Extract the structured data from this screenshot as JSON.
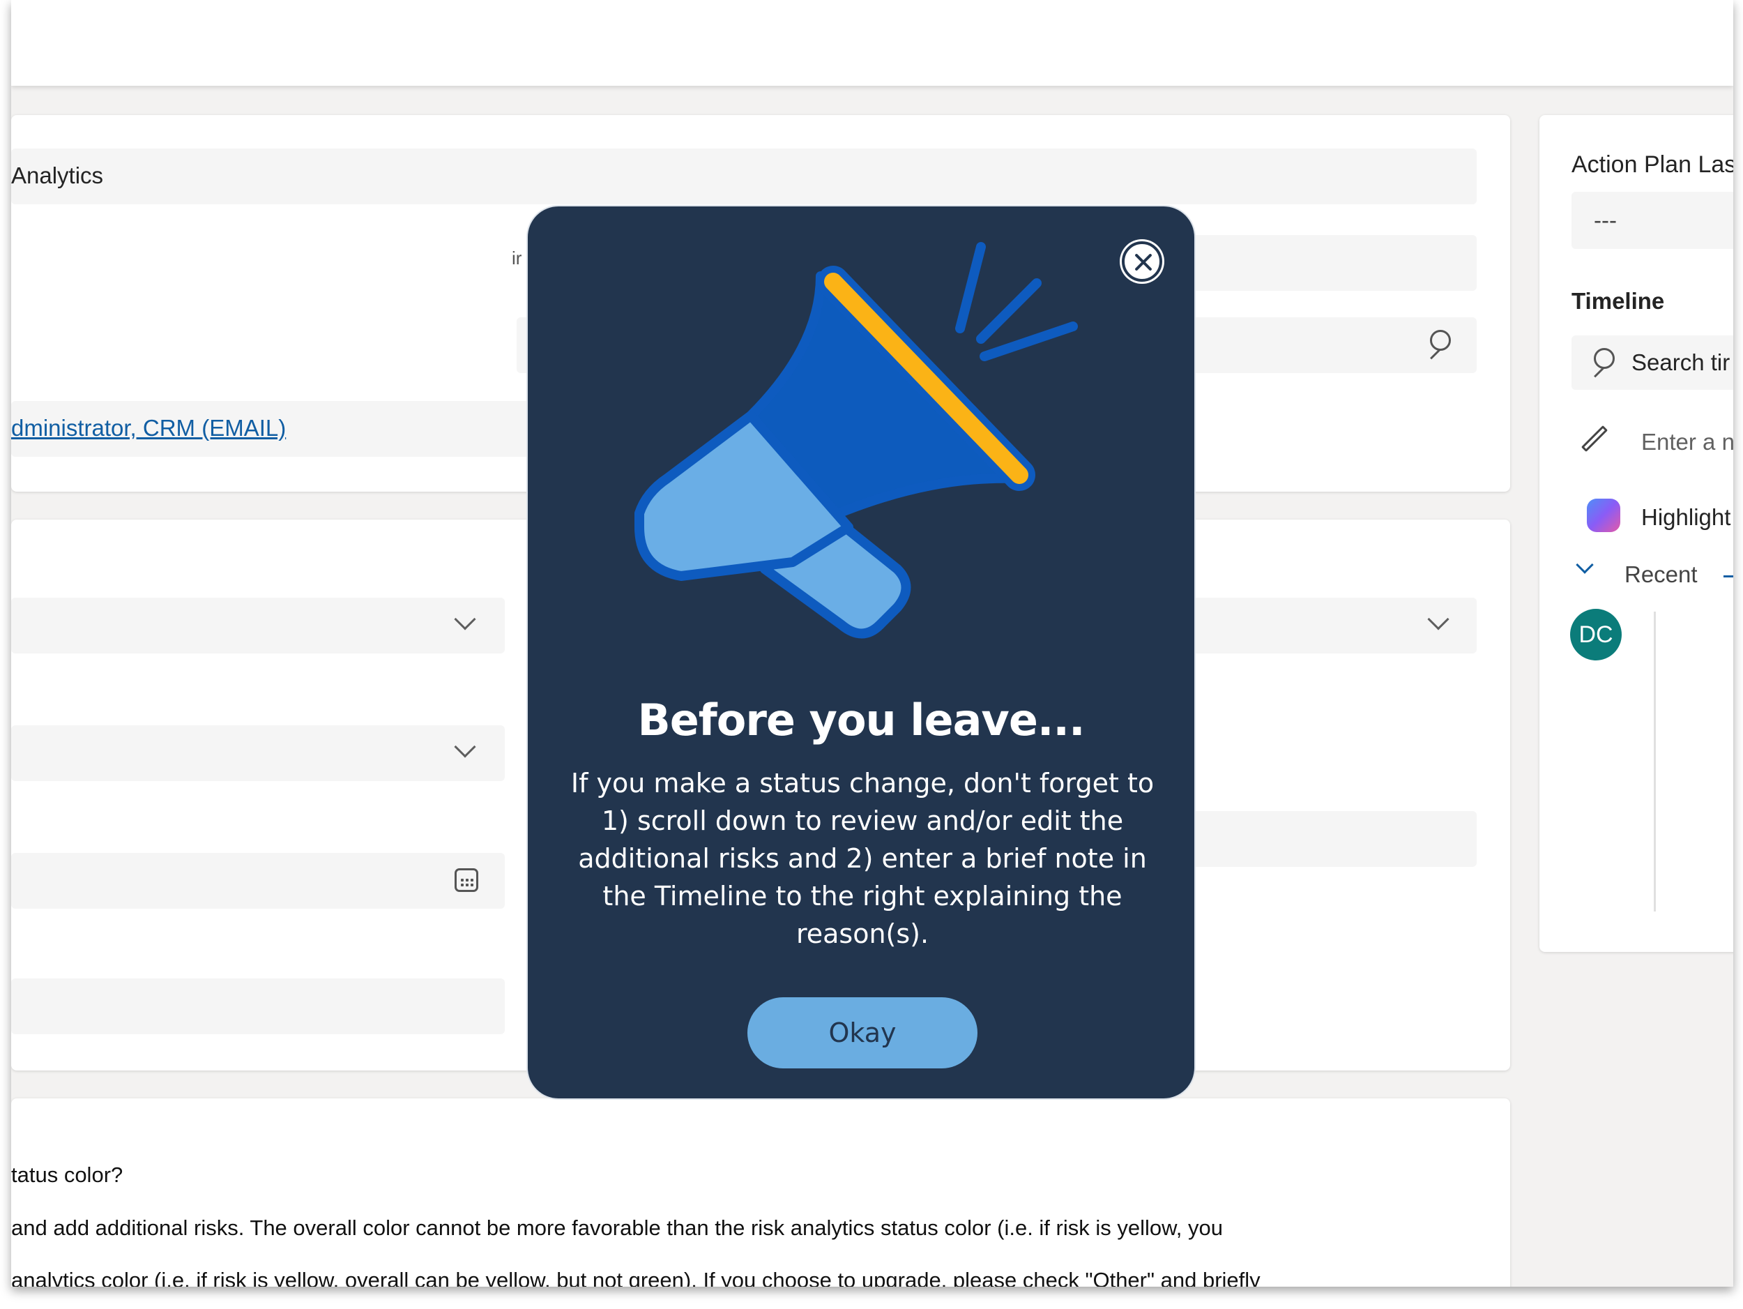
{
  "form": {
    "section1": {
      "name_value": "Analytics",
      "partial_label": "ir",
      "owner_value": "dministrator, CRM (EMAIL)"
    },
    "section3": {
      "question": "tatus color?",
      "line1": " and add additional risks. The overall color cannot be more favorable than the risk analytics status color (i.e. if risk is yellow, you",
      "line2": "analytics color (i.e. if risk is yellow, overall can be yellow, but not green). If you choose to upgrade, please check \"Other\" and briefly"
    }
  },
  "sidebar": {
    "action_plan_label": "Action Plan Las",
    "action_plan_value": "---",
    "timeline_label": "Timeline",
    "search_placeholder": "Search tir",
    "note_placeholder": "Enter a no",
    "highlights_label": "Highlight",
    "recent_label": "Recent",
    "avatar_initials": "DC",
    "avatar_color": "#0b7c7a"
  },
  "modal": {
    "title": "Before you leave...",
    "message": "If you make a status change, don't forget to 1) scroll down to review and/or edit the additional risks and 2) enter a brief note in the Timeline to the right explaining the reason(s).",
    "okay_label": "Okay",
    "background_color": "#22354e",
    "button_color": "#6aade1",
    "icon": "megaphone-icon"
  }
}
